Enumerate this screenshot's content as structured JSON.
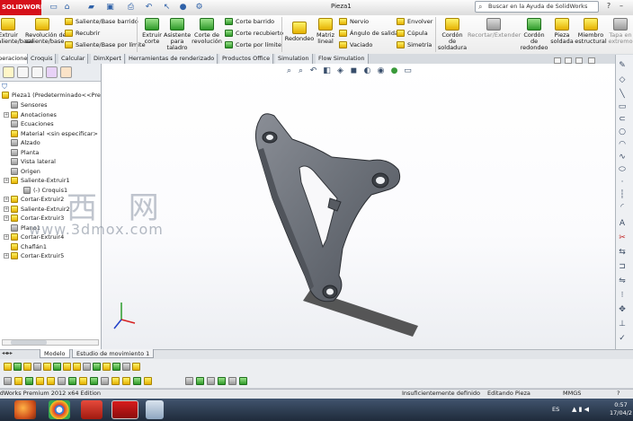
{
  "app": {
    "logo_text": "SOLIDWORKS",
    "document_title": "Pieza1",
    "search_placeholder": "Buscar en la Ayuda de SolidWorks"
  },
  "command_manager": {
    "big_buttons": [
      {
        "label": "Extruir\nsaliente/base",
        "icon": "extrude-boss-icon"
      },
      {
        "label": "Revolución de\nsaliente/base",
        "icon": "revolve-boss-icon"
      },
      {
        "label": "Extruir\ncorte",
        "icon": "extrude-cut-icon"
      },
      {
        "label": "Asistente\npara\ntaladro",
        "icon": "hole-wizard-icon"
      },
      {
        "label": "Corte de\nrevolución",
        "icon": "revolve-cut-icon"
      },
      {
        "label": "Redondeo",
        "icon": "fillet-icon"
      },
      {
        "label": "Matriz\nlineal",
        "icon": "linear-pattern-icon"
      },
      {
        "label": "Cordón\nde\nsoldadura",
        "icon": "weld-bead-icon"
      },
      {
        "label": "Recortar/Extender",
        "icon": "trim-extend-icon"
      },
      {
        "label": "Cordón\nde\nredondeo",
        "icon": "fillet-bead-icon"
      },
      {
        "label": "Pieza\nsoldada",
        "icon": "weldment-icon"
      },
      {
        "label": "Miembro\nestructural",
        "icon": "structural-member-icon"
      },
      {
        "label": "Tapa en\nextremo",
        "icon": "end-cap-icon"
      }
    ],
    "small_buttons": [
      {
        "label": "Saliente/Base barrido",
        "icon": "swept-boss-icon"
      },
      {
        "label": "Recubrir",
        "icon": "loft-icon"
      },
      {
        "label": "Saliente/Base por límite",
        "icon": "boundary-boss-icon"
      },
      {
        "label": "Corte barrido",
        "icon": "swept-cut-icon"
      },
      {
        "label": "Corte recubierto",
        "icon": "lofted-cut-icon"
      },
      {
        "label": "Corte por límite",
        "icon": "boundary-cut-icon"
      },
      {
        "label": "Nervio",
        "icon": "rib-icon"
      },
      {
        "label": "Ángulo de salida",
        "icon": "draft-icon"
      },
      {
        "label": "Vaciado",
        "icon": "shell-icon"
      },
      {
        "label": "Envolver",
        "icon": "wrap-icon"
      },
      {
        "label": "Cúpula",
        "icon": "dome-icon"
      },
      {
        "label": "Simetría",
        "icon": "mirror-icon"
      }
    ]
  },
  "tabs": [
    "Operaciones",
    "Croquis",
    "Calcular",
    "DimXpert",
    "Herramientas de renderizado",
    "Productos Office",
    "Simulation",
    "Flow Simulation"
  ],
  "feature_tree": {
    "root": "Pieza1  (Predeterminado<<Pre",
    "items": [
      {
        "label": "Sensores",
        "icon": "sensor-icon",
        "expand": false
      },
      {
        "label": "Anotaciones",
        "icon": "annotations-icon",
        "expand": true
      },
      {
        "label": "Ecuaciones",
        "icon": "equations-icon",
        "expand": false
      },
      {
        "label": "Material <sin especificar>",
        "icon": "material-icon",
        "expand": false
      },
      {
        "label": "Alzado",
        "icon": "plane-icon",
        "expand": false
      },
      {
        "label": "Planta",
        "icon": "plane-icon",
        "expand": false
      },
      {
        "label": "Vista lateral",
        "icon": "plane-icon",
        "expand": false
      },
      {
        "label": "Origen",
        "icon": "origin-icon",
        "expand": false
      },
      {
        "label": "Saliente-Extruir1",
        "icon": "extrude-feature-icon",
        "expand": true
      },
      {
        "label": "(-) Croquis1",
        "icon": "sketch-icon",
        "expand": false,
        "child": true
      },
      {
        "label": "Cortar-Extruir2",
        "icon": "cut-feature-icon",
        "expand": true
      },
      {
        "label": "Saliente-Extruir2",
        "icon": "extrude-feature-icon",
        "expand": true
      },
      {
        "label": "Cortar-Extruir3",
        "icon": "cut-feature-icon",
        "expand": true
      },
      {
        "label": "Plano1",
        "icon": "plane-icon",
        "expand": false
      },
      {
        "label": "Cortar-Extruir4",
        "icon": "cut-feature-icon",
        "expand": true
      },
      {
        "label": "Chaflán1",
        "icon": "chamfer-icon",
        "expand": false
      },
      {
        "label": "Cortar-Extruir5",
        "icon": "cut-feature-icon",
        "expand": true
      }
    ]
  },
  "watermark": {
    "line1": "西 网",
    "line2": "www.3dmox.com"
  },
  "bottom_tabs": [
    "Modelo",
    "Estudio de movimiento 1"
  ],
  "status": {
    "edition": "SolidWorks Premium 2012 x64 Edition",
    "definition": "Insuficientemente definido",
    "mode": "Editando Pieza",
    "units": "MMGS",
    "help": "?"
  },
  "taskbar": {
    "lang": "ES",
    "time": "0:57",
    "date": "17/04/2"
  },
  "colors": {
    "accent": "#d6101a",
    "model": "#6c7079",
    "taskbar": "#2b384b"
  }
}
